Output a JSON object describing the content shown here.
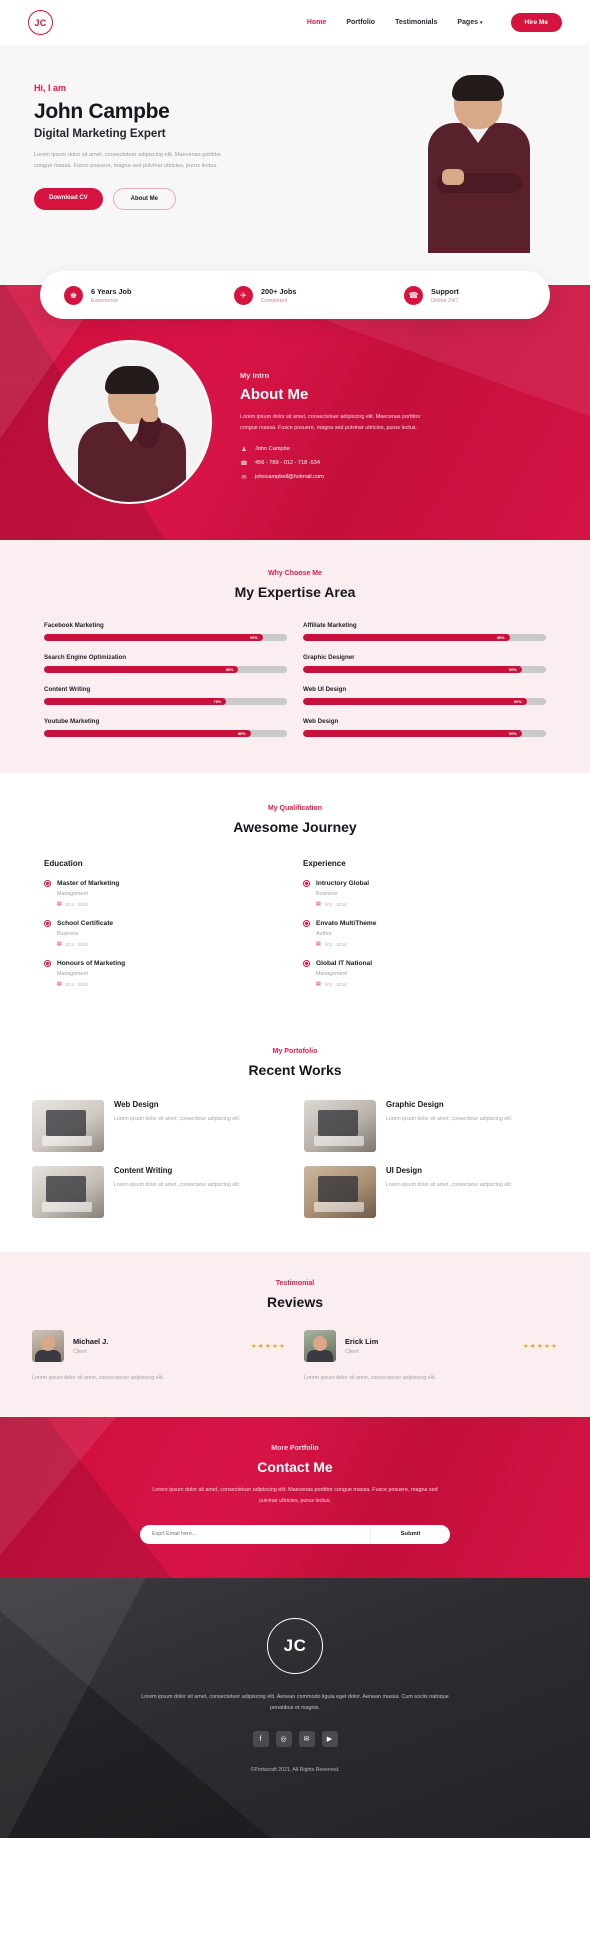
{
  "colors": {
    "primary": "#d6133f",
    "accent": "#e01b4c",
    "soft_pink": "#fbeef1",
    "star": "#f0a81e"
  },
  "nav": {
    "logo": "JC",
    "links": [
      {
        "label": "Home",
        "active": true
      },
      {
        "label": "Portfolio",
        "active": false
      },
      {
        "label": "Testimonials",
        "active": false
      },
      {
        "label": "Pages",
        "active": false,
        "caret": "▾"
      }
    ],
    "cta": "Hire Me"
  },
  "hero": {
    "greeting": "Hi, I am",
    "name": "John Campbe",
    "role": "Digital Marketing Expert",
    "description": "Lorem ipsum dolor sit amet, consectetuer adipiscing elit. Maecenas porttitor congue massa. Fusce posuere, magna sed pulvinar ultricies, purus lectus.",
    "primary_button": "Download CV",
    "secondary_button": "About Me"
  },
  "stats": [
    {
      "icon": "trophy-icon",
      "glyph": "♚",
      "title": "6 Years Job",
      "subtitle": "Experience"
    },
    {
      "icon": "rocket-icon",
      "glyph": "✈",
      "title": "200+ Jobs",
      "subtitle": "Completed"
    },
    {
      "icon": "headset-icon",
      "glyph": "☎",
      "title": "Support",
      "subtitle": "Online 24/7"
    }
  ],
  "about": {
    "subtitle": "My Intro",
    "title": "About Me",
    "description": "Lorem ipsum dolor sit amet, consectetuer adipiscing elit. Maecenas porttitor congue massa. Fusce posuere, magna sed pulvinar ultricies, purus lectus.",
    "contacts": [
      {
        "icon": "user-icon",
        "glyph": "♟",
        "text": "John Campbe"
      },
      {
        "icon": "phone-icon",
        "glyph": "☎",
        "text": "456 - 789 - 012 - 718 -534"
      },
      {
        "icon": "email-icon",
        "glyph": "✉",
        "text": "johncampbell@hotmail.com"
      }
    ]
  },
  "expertise": {
    "subtitle": "Why Choose Me",
    "title": "My Expertise Area",
    "left_skills": [
      {
        "label": "Facebook Marketing",
        "percent": 90,
        "percent_label": "90%"
      },
      {
        "label": "Search Engine Optimization",
        "percent": 80,
        "percent_label": "80%"
      },
      {
        "label": "Content Writing",
        "percent": 75,
        "percent_label": "75%"
      },
      {
        "label": "Youtube Marketing",
        "percent": 85,
        "percent_label": "85%"
      }
    ],
    "right_skills": [
      {
        "label": "Affiliate Marketing",
        "percent": 85,
        "percent_label": "85%"
      },
      {
        "label": "Graphic Designer",
        "percent": 90,
        "percent_label": "90%"
      },
      {
        "label": "Web UI Design",
        "percent": 92,
        "percent_label": "92%"
      },
      {
        "label": "Web Design",
        "percent": 90,
        "percent_label": "90%"
      }
    ]
  },
  "qualification": {
    "subtitle": "My Qualification",
    "title": "Awesome Journey",
    "education_heading": "Education",
    "experience_heading": "Experience",
    "education": [
      {
        "title": "Master of Marketing",
        "subtitle": "Management",
        "date": "201 - 2014"
      },
      {
        "title": "School Certificate",
        "subtitle": "Business",
        "date": "201 - 2014"
      },
      {
        "title": "Honours of Marketing",
        "subtitle": "Management",
        "date": "201 - 2014"
      }
    ],
    "experience": [
      {
        "title": "Intructory Global",
        "subtitle": "Business",
        "date": "201 - 2014"
      },
      {
        "title": "Envato MultiTheme",
        "subtitle": "Author",
        "date": "201 - 2014"
      },
      {
        "title": "Global IT National",
        "subtitle": "Management",
        "date": "201 - 2014"
      }
    ]
  },
  "portfolio": {
    "subtitle": "My Portofolio",
    "title": "Recent Works",
    "items": [
      {
        "title": "Web Design",
        "description": "Lorem ipsum dolor sit amet, consectetur adipiscing elit."
      },
      {
        "title": "Graphic Design",
        "description": "Lorem ipsum dolor sit amet, consectetur adipiscing elit."
      },
      {
        "title": "Content Writing",
        "description": "Lorem ipsum dolor sit amet, consectetur adipiscing elit."
      },
      {
        "title": "UI Design",
        "description": "Lorem ipsum dolor sit amet, consectetur adipiscing elit."
      }
    ]
  },
  "testimonials": {
    "subtitle": "Testimonial",
    "title": "Reviews",
    "items": [
      {
        "name": "Michael J.",
        "role": "Client",
        "stars": "★★★★★",
        "text": "Lorem ipsum dolor sit amet, consectetuer adipiscing elit."
      },
      {
        "name": "Erick Lim",
        "role": "Client",
        "stars": "★★★★★",
        "text": "Lorem ipsum dolor sit amet, consectetuer adipiscing elit."
      }
    ]
  },
  "contact": {
    "subtitle": "More Portfolio",
    "title": "Contact Me",
    "description": "Lorem ipsum dolor sit amet, consectetuer adipiscing elit. Maecenas porttitor congue massa. Fusce posuere, magna sed pulvinar ultricies, purus lectus.",
    "input_placeholder": "Exprt Email here...",
    "submit_label": "Submit"
  },
  "footer": {
    "logo": "JC",
    "description": "Lorem ipsum dolor sit amet, consectetuer adipiscing elit. Aenean commodo ligula eget dolor. Aenean massa. Cum sociis natoque penatibus et magnis.",
    "social": [
      {
        "name": "facebook-icon",
        "glyph": "f"
      },
      {
        "name": "instagram-icon",
        "glyph": "◎"
      },
      {
        "name": "twitter-icon",
        "glyph": "✉"
      },
      {
        "name": "youtube-icon",
        "glyph": "▶"
      }
    ],
    "copyright": "©Portacraft 2021, All Rights Reserved."
  }
}
